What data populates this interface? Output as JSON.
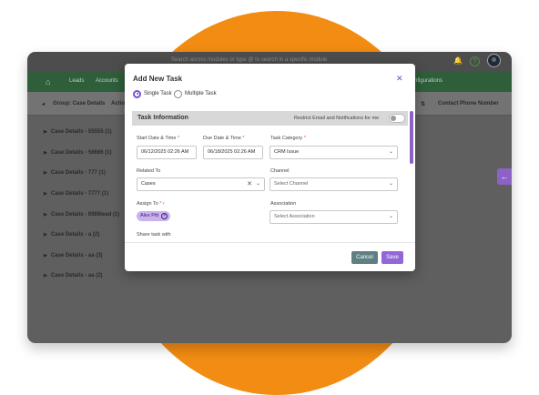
{
  "topbar": {
    "search_text": "Search across modules or type @ to search in a specific module"
  },
  "navbar": {
    "items": [
      "Leads",
      "Accounts",
      "nfigurations"
    ]
  },
  "list_header": {
    "group_label": "Group: Case Details",
    "action_partial": "Actio",
    "contact_phone": "Contact Phone Number"
  },
  "groups": [
    "Case Details - 55555 (1)",
    "Case Details - 56666 (1)",
    "Case Details - 777 (1)",
    "Case Details - 7777 (1)",
    "Case Details - 8989lead (1)",
    "Case Details - a (2)",
    "Case Details - aa (3)",
    "Case Details - aa (2)"
  ],
  "modal": {
    "title": "Add New Task",
    "radio_single": "Single Task",
    "radio_multiple": "Multiple Task",
    "section_title": "Task Information",
    "restrict_label": "Restrict Email and Notifications for me",
    "start_label": "Start Date & Time",
    "start_value": "06/12/2025 02:26 AM",
    "due_label": "Due Date & Time",
    "due_value": "06/18/2025 02:26 AM",
    "category_label": "Task Category",
    "category_value": "CRM Issue",
    "related_label": "Related To",
    "related_value": "Cases",
    "channel_label": "Channel",
    "channel_placeholder": "Select Channel",
    "assign_label": "Assign To",
    "assignee": "Alex Pitt",
    "association_label": "Association",
    "association_placeholder": "Select Association",
    "share_label": "Share task with",
    "cancel": "Cancel",
    "save": "Save"
  },
  "colors": {
    "accent": "#7b4fd1",
    "orange": "#f28c13",
    "nav_green": "#2f5f3a"
  }
}
